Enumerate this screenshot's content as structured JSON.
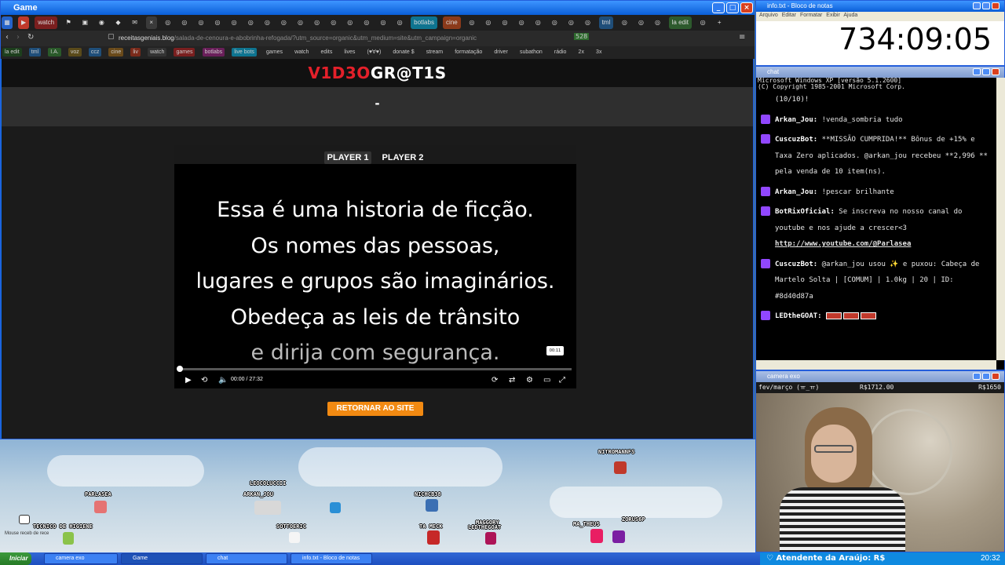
{
  "game_window": {
    "title": "Game",
    "tabs": [
      "watch",
      "botlabs",
      "cine",
      "tml",
      "la edit"
    ],
    "url_host": "receitasgeniais.blog",
    "url_path": "/salada-de-cenoura-e-abobrinha-refogada/?utm_source=organic&utm_medium=site&utm_campaign=organic",
    "bookmarks": [
      "la edit",
      "tml",
      "I.A.",
      "voz",
      "ccz",
      "cine",
      "liv",
      "watch",
      "games",
      "botlabs",
      "live bots",
      "games",
      "watch",
      "edits",
      "lives",
      "(♥∀♥)",
      "donate $",
      "stream",
      "formatação",
      "driver",
      "subathon",
      "rádio",
      "2x",
      "3x"
    ],
    "badge_count": "528"
  },
  "site": {
    "logo_red_1": "V1D3O",
    "logo_white": "GR@T1S",
    "page_title": "-",
    "player_tabs": [
      "PLAYER 1",
      "PLAYER 2"
    ],
    "video_lines": [
      "Essa é uma historia de ficção.",
      "Os nomes das pessoas,",
      "lugares e grupos são imaginários.",
      "Obedeça as leis de trânsito",
      "e dirija com segurança."
    ],
    "time_display": "00:00 / 27:32",
    "time_tooltip": "00:11",
    "return_button": "RETORNAR AO SITE"
  },
  "desktop_sprites": [
    {
      "name": "NITROMANNFS"
    },
    {
      "name": "PARLASEA"
    },
    {
      "name": "LEOCOLUCCII"
    },
    {
      "name": "ARKAN_JOU"
    },
    {
      "name": "NICHCB38"
    },
    {
      "name": "TECNICO DE HIGIENE"
    },
    {
      "name": "SOTTOERIC"
    },
    {
      "name": "TA MECK"
    },
    {
      "name": "MAGGORY"
    },
    {
      "name": "LEDTHEGOAT"
    },
    {
      "name": "MA_THEUS"
    },
    {
      "name": "ZORUS6P"
    },
    {
      "name": "Mouse receb de rece"
    }
  ],
  "notepad": {
    "title": "info.txt - Bloco de notas",
    "menu": [
      "Arquivo",
      "Editar",
      "Formatar",
      "Exibir",
      "Ajuda"
    ],
    "timer": "734:09:05"
  },
  "chat": {
    "title": "chat",
    "header_lines": [
      "Microsoft Windows XP [versão 5.1.2600]",
      "(C) Copyright 1985-2001 Microsoft Corp."
    ],
    "first_line": "(10/10)!",
    "messages": [
      {
        "user": "Arkan_Jou:",
        "text": "!venda_sombria tudo"
      },
      {
        "user": "CuscuzBot:",
        "text": "**MISSÃO CUMPRIDA!** Bônus de +15% e Taxa Zero aplicados. @arkan_jou recebeu **2,996 ** pela venda de 10 item(ns)."
      },
      {
        "user": "Arkan_Jou:",
        "text": "!pescar brilhante"
      },
      {
        "user": "BotRixOficial:",
        "text": "Se inscreva no nosso canal do youtube e nos ajude a crescer<3",
        "link": "http://www.youtube.com/@Parlasea"
      },
      {
        "user": "CuscuzBot:",
        "text": "@arkan_jou usou ✨ e puxou: Cabeça de Martelo Solta | [COMUM] | 1.0kg | 20 | ID: #8d40d87a"
      },
      {
        "user": "LEDtheGOAT:",
        "text": ""
      }
    ]
  },
  "camera": {
    "title": "camera exo",
    "left_label": "fev/março (ㅠ_ㅠ)",
    "amount": "R$1712.00",
    "goal": "R$1650"
  },
  "taskbar": {
    "start": "Iniciar",
    "tasks": [
      "camera exo",
      "Game",
      "chat",
      "info.txt - Bloco de notas"
    ],
    "tray_text": "♡ Atendente da Araújo: R$",
    "clock": "20:32"
  }
}
